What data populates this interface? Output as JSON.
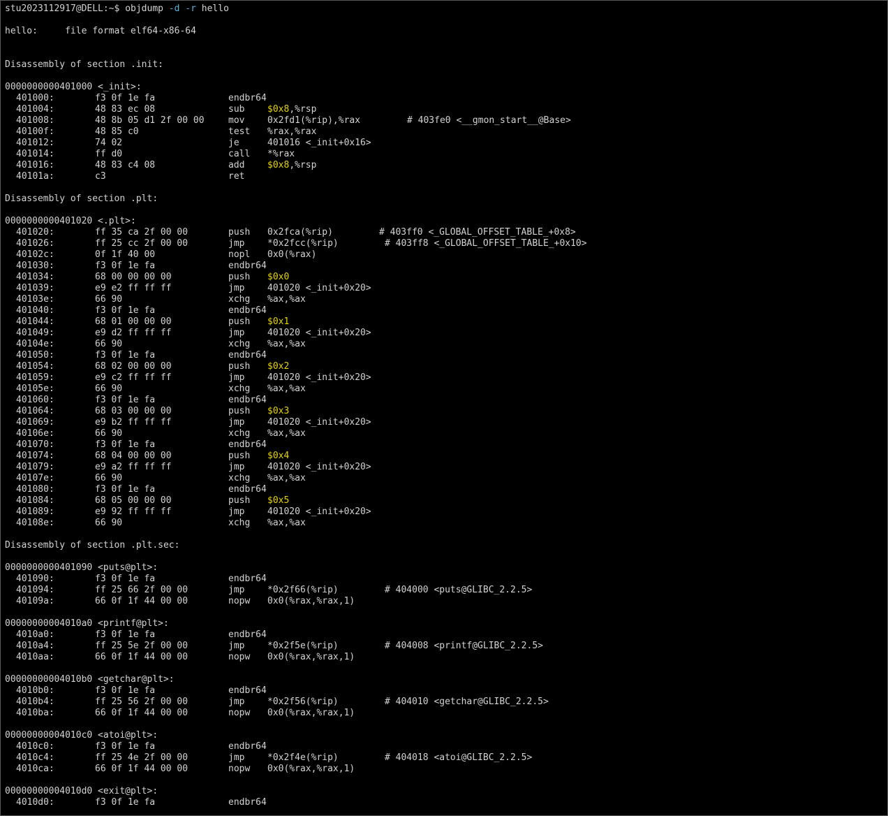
{
  "colors": {
    "background": "#000000",
    "text": "#d2d2d2",
    "immediate": "#e6d400",
    "command_flag": "#5fb4d8"
  },
  "prompt": {
    "text": "stu2023112917@DELL:~$ ",
    "cmd": "objdump",
    "flag_d": "-d",
    "flag_r": "-r",
    "file": "hello"
  },
  "header": {
    "file_format": "hello:     file format elf64-x86-64"
  },
  "sections": [
    {
      "heading": "Disassembly of section .init:",
      "functions": [
        {
          "label": "0000000000401000 <_init>:",
          "instructions": [
            {
              "addr": "401000:",
              "bytes": "f3 0f 1e fa",
              "mnemonic": "endbr64",
              "pre": "",
              "imm": "",
              "post": "",
              "comment": ""
            },
            {
              "addr": "401004:",
              "bytes": "48 83 ec 08",
              "mnemonic": "sub",
              "pre": "",
              "imm": "$0x8",
              "post": ",%rsp",
              "comment": ""
            },
            {
              "addr": "401008:",
              "bytes": "48 8b 05 d1 2f 00 00",
              "mnemonic": "mov",
              "pre": "0x2fd1(%rip),%rax",
              "imm": "",
              "post": "",
              "comment": "# 403fe0 <__gmon_start__@Base>",
              "cpos": "l"
            },
            {
              "addr": "40100f:",
              "bytes": "48 85 c0",
              "mnemonic": "test",
              "pre": "%rax,%rax",
              "imm": "",
              "post": "",
              "comment": ""
            },
            {
              "addr": "401012:",
              "bytes": "74 02",
              "mnemonic": "je",
              "pre": "401016 <_init+0x16>",
              "imm": "",
              "post": "",
              "comment": ""
            },
            {
              "addr": "401014:",
              "bytes": "ff d0",
              "mnemonic": "call",
              "pre": "*%rax",
              "imm": "",
              "post": "",
              "comment": ""
            },
            {
              "addr": "401016:",
              "bytes": "48 83 c4 08",
              "mnemonic": "add",
              "pre": "",
              "imm": "$0x8",
              "post": ",%rsp",
              "comment": ""
            },
            {
              "addr": "40101a:",
              "bytes": "c3",
              "mnemonic": "ret",
              "pre": "",
              "imm": "",
              "post": "",
              "comment": ""
            }
          ]
        }
      ]
    },
    {
      "heading": "Disassembly of section .plt:",
      "functions": [
        {
          "label": "0000000000401020 <.plt>:",
          "instructions": [
            {
              "addr": "401020:",
              "bytes": "ff 35 ca 2f 00 00",
              "mnemonic": "push",
              "pre": "0x2fca(%rip)",
              "imm": "",
              "post": "",
              "comment": "# 403ff0 <_GLOBAL_OFFSET_TABLE_+0x8>",
              "cpos": "s"
            },
            {
              "addr": "401026:",
              "bytes": "ff 25 cc 2f 00 00",
              "mnemonic": "jmp",
              "pre": "*0x2fcc(%rip)",
              "imm": "",
              "post": "",
              "comment": "# 403ff8 <_GLOBAL_OFFSET_TABLE_+0x10>",
              "cpos": "m"
            },
            {
              "addr": "40102c:",
              "bytes": "0f 1f 40 00",
              "mnemonic": "nopl",
              "pre": "0x0(%rax)",
              "imm": "",
              "post": "",
              "comment": ""
            },
            {
              "addr": "401030:",
              "bytes": "f3 0f 1e fa",
              "mnemonic": "endbr64",
              "pre": "",
              "imm": "",
              "post": "",
              "comment": ""
            },
            {
              "addr": "401034:",
              "bytes": "68 00 00 00 00",
              "mnemonic": "push",
              "pre": "",
              "imm": "$0x0",
              "post": "",
              "comment": ""
            },
            {
              "addr": "401039:",
              "bytes": "e9 e2 ff ff ff",
              "mnemonic": "jmp",
              "pre": "401020 <_init+0x20>",
              "imm": "",
              "post": "",
              "comment": ""
            },
            {
              "addr": "40103e:",
              "bytes": "66 90",
              "mnemonic": "xchg",
              "pre": "%ax,%ax",
              "imm": "",
              "post": "",
              "comment": ""
            },
            {
              "addr": "401040:",
              "bytes": "f3 0f 1e fa",
              "mnemonic": "endbr64",
              "pre": "",
              "imm": "",
              "post": "",
              "comment": ""
            },
            {
              "addr": "401044:",
              "bytes": "68 01 00 00 00",
              "mnemonic": "push",
              "pre": "",
              "imm": "$0x1",
              "post": "",
              "comment": ""
            },
            {
              "addr": "401049:",
              "bytes": "e9 d2 ff ff ff",
              "mnemonic": "jmp",
              "pre": "401020 <_init+0x20>",
              "imm": "",
              "post": "",
              "comment": ""
            },
            {
              "addr": "40104e:",
              "bytes": "66 90",
              "mnemonic": "xchg",
              "pre": "%ax,%ax",
              "imm": "",
              "post": "",
              "comment": ""
            },
            {
              "addr": "401050:",
              "bytes": "f3 0f 1e fa",
              "mnemonic": "endbr64",
              "pre": "",
              "imm": "",
              "post": "",
              "comment": ""
            },
            {
              "addr": "401054:",
              "bytes": "68 02 00 00 00",
              "mnemonic": "push",
              "pre": "",
              "imm": "$0x2",
              "post": "",
              "comment": ""
            },
            {
              "addr": "401059:",
              "bytes": "e9 c2 ff ff ff",
              "mnemonic": "jmp",
              "pre": "401020 <_init+0x20>",
              "imm": "",
              "post": "",
              "comment": ""
            },
            {
              "addr": "40105e:",
              "bytes": "66 90",
              "mnemonic": "xchg",
              "pre": "%ax,%ax",
              "imm": "",
              "post": "",
              "comment": ""
            },
            {
              "addr": "401060:",
              "bytes": "f3 0f 1e fa",
              "mnemonic": "endbr64",
              "pre": "",
              "imm": "",
              "post": "",
              "comment": ""
            },
            {
              "addr": "401064:",
              "bytes": "68 03 00 00 00",
              "mnemonic": "push",
              "pre": "",
              "imm": "$0x3",
              "post": "",
              "comment": ""
            },
            {
              "addr": "401069:",
              "bytes": "e9 b2 ff ff ff",
              "mnemonic": "jmp",
              "pre": "401020 <_init+0x20>",
              "imm": "",
              "post": "",
              "comment": ""
            },
            {
              "addr": "40106e:",
              "bytes": "66 90",
              "mnemonic": "xchg",
              "pre": "%ax,%ax",
              "imm": "",
              "post": "",
              "comment": ""
            },
            {
              "addr": "401070:",
              "bytes": "f3 0f 1e fa",
              "mnemonic": "endbr64",
              "pre": "",
              "imm": "",
              "post": "",
              "comment": ""
            },
            {
              "addr": "401074:",
              "bytes": "68 04 00 00 00",
              "mnemonic": "push",
              "pre": "",
              "imm": "$0x4",
              "post": "",
              "comment": ""
            },
            {
              "addr": "401079:",
              "bytes": "e9 a2 ff ff ff",
              "mnemonic": "jmp",
              "pre": "401020 <_init+0x20>",
              "imm": "",
              "post": "",
              "comment": ""
            },
            {
              "addr": "40107e:",
              "bytes": "66 90",
              "mnemonic": "xchg",
              "pre": "%ax,%ax",
              "imm": "",
              "post": "",
              "comment": ""
            },
            {
              "addr": "401080:",
              "bytes": "f3 0f 1e fa",
              "mnemonic": "endbr64",
              "pre": "",
              "imm": "",
              "post": "",
              "comment": ""
            },
            {
              "addr": "401084:",
              "bytes": "68 05 00 00 00",
              "mnemonic": "push",
              "pre": "",
              "imm": "$0x5",
              "post": "",
              "comment": ""
            },
            {
              "addr": "401089:",
              "bytes": "e9 92 ff ff ff",
              "mnemonic": "jmp",
              "pre": "401020 <_init+0x20>",
              "imm": "",
              "post": "",
              "comment": ""
            },
            {
              "addr": "40108e:",
              "bytes": "66 90",
              "mnemonic": "xchg",
              "pre": "%ax,%ax",
              "imm": "",
              "post": "",
              "comment": ""
            }
          ]
        }
      ]
    },
    {
      "heading": "Disassembly of section .plt.sec:",
      "functions": [
        {
          "label": "0000000000401090 <puts@plt>:",
          "instructions": [
            {
              "addr": "401090:",
              "bytes": "f3 0f 1e fa",
              "mnemonic": "endbr64",
              "pre": "",
              "imm": "",
              "post": "",
              "comment": ""
            },
            {
              "addr": "401094:",
              "bytes": "ff 25 66 2f 00 00",
              "mnemonic": "jmp",
              "pre": "*0x2f66(%rip)",
              "imm": "",
              "post": "",
              "comment": "# 404000 <puts@GLIBC_2.2.5>",
              "cpos": "m"
            },
            {
              "addr": "40109a:",
              "bytes": "66 0f 1f 44 00 00",
              "mnemonic": "nopw",
              "pre": "0x0(%rax,%rax,1)",
              "imm": "",
              "post": "",
              "comment": ""
            }
          ]
        },
        {
          "label": "00000000004010a0 <printf@plt>:",
          "instructions": [
            {
              "addr": "4010a0:",
              "bytes": "f3 0f 1e fa",
              "mnemonic": "endbr64",
              "pre": "",
              "imm": "",
              "post": "",
              "comment": ""
            },
            {
              "addr": "4010a4:",
              "bytes": "ff 25 5e 2f 00 00",
              "mnemonic": "jmp",
              "pre": "*0x2f5e(%rip)",
              "imm": "",
              "post": "",
              "comment": "# 404008 <printf@GLIBC_2.2.5>",
              "cpos": "m"
            },
            {
              "addr": "4010aa:",
              "bytes": "66 0f 1f 44 00 00",
              "mnemonic": "nopw",
              "pre": "0x0(%rax,%rax,1)",
              "imm": "",
              "post": "",
              "comment": ""
            }
          ]
        },
        {
          "label": "00000000004010b0 <getchar@plt>:",
          "instructions": [
            {
              "addr": "4010b0:",
              "bytes": "f3 0f 1e fa",
              "mnemonic": "endbr64",
              "pre": "",
              "imm": "",
              "post": "",
              "comment": ""
            },
            {
              "addr": "4010b4:",
              "bytes": "ff 25 56 2f 00 00",
              "mnemonic": "jmp",
              "pre": "*0x2f56(%rip)",
              "imm": "",
              "post": "",
              "comment": "# 404010 <getchar@GLIBC_2.2.5>",
              "cpos": "m"
            },
            {
              "addr": "4010ba:",
              "bytes": "66 0f 1f 44 00 00",
              "mnemonic": "nopw",
              "pre": "0x0(%rax,%rax,1)",
              "imm": "",
              "post": "",
              "comment": ""
            }
          ]
        },
        {
          "label": "00000000004010c0 <atoi@plt>:",
          "instructions": [
            {
              "addr": "4010c0:",
              "bytes": "f3 0f 1e fa",
              "mnemonic": "endbr64",
              "pre": "",
              "imm": "",
              "post": "",
              "comment": ""
            },
            {
              "addr": "4010c4:",
              "bytes": "ff 25 4e 2f 00 00",
              "mnemonic": "jmp",
              "pre": "*0x2f4e(%rip)",
              "imm": "",
              "post": "",
              "comment": "# 404018 <atoi@GLIBC_2.2.5>",
              "cpos": "m"
            },
            {
              "addr": "4010ca:",
              "bytes": "66 0f 1f 44 00 00",
              "mnemonic": "nopw",
              "pre": "0x0(%rax,%rax,1)",
              "imm": "",
              "post": "",
              "comment": ""
            }
          ]
        },
        {
          "label": "00000000004010d0 <exit@plt>:",
          "instructions": [
            {
              "addr": "4010d0:",
              "bytes": "f3 0f 1e fa",
              "mnemonic": "endbr64",
              "pre": "",
              "imm": "",
              "post": "",
              "comment": ""
            }
          ]
        }
      ]
    }
  ]
}
